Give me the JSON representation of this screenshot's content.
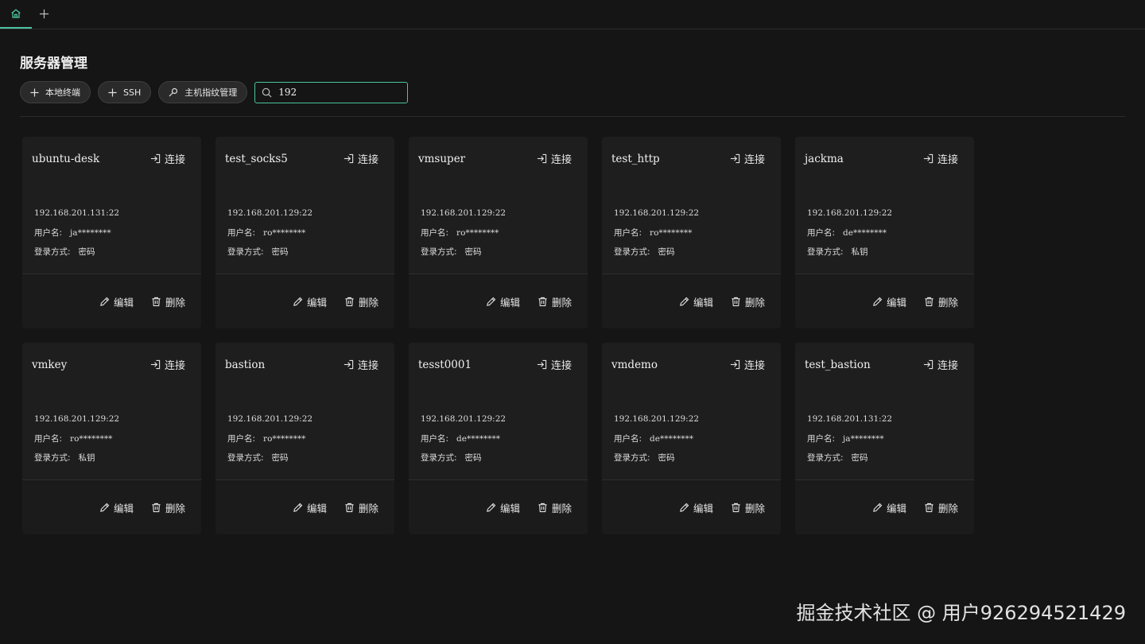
{
  "page": {
    "title": "服务器管理"
  },
  "toolbar": {
    "local_terminal_label": "本地终端",
    "ssh_label": "SSH",
    "fingerprint_label": "主机指纹管理",
    "search_value": "192"
  },
  "card_labels": {
    "connect": "连接",
    "edit": "编辑",
    "delete": "删除",
    "username_label": "用户名:",
    "login_label": "登录方式:"
  },
  "servers": [
    {
      "name": "ubuntu-desk",
      "address": "192.168.201.131:22",
      "username": "ja********",
      "login": "密码"
    },
    {
      "name": "test_socks5",
      "address": "192.168.201.129:22",
      "username": "ro********",
      "login": "密码"
    },
    {
      "name": "vmsuper",
      "address": "192.168.201.129:22",
      "username": "ro********",
      "login": "密码"
    },
    {
      "name": "test_http",
      "address": "192.168.201.129:22",
      "username": "ro********",
      "login": "密码"
    },
    {
      "name": "jackma",
      "address": "192.168.201.129:22",
      "username": "de********",
      "login": "私钥"
    },
    {
      "name": "vmkey",
      "address": "192.168.201.129:22",
      "username": "ro********",
      "login": "私钥"
    },
    {
      "name": "bastion",
      "address": "192.168.201.129:22",
      "username": "ro********",
      "login": "密码"
    },
    {
      "name": "tesst0001",
      "address": "192.168.201.129:22",
      "username": "de********",
      "login": "密码"
    },
    {
      "name": "vmdemo",
      "address": "192.168.201.129:22",
      "username": "de********",
      "login": "密码"
    },
    {
      "name": "test_bastion",
      "address": "192.168.201.131:22",
      "username": "ja********",
      "login": "密码"
    }
  ],
  "watermark": "掘金技术社区 @ 用户926294521429",
  "colors": {
    "accent": "#4fc3a1",
    "background": "#151515",
    "card": "#1e1e1e"
  }
}
